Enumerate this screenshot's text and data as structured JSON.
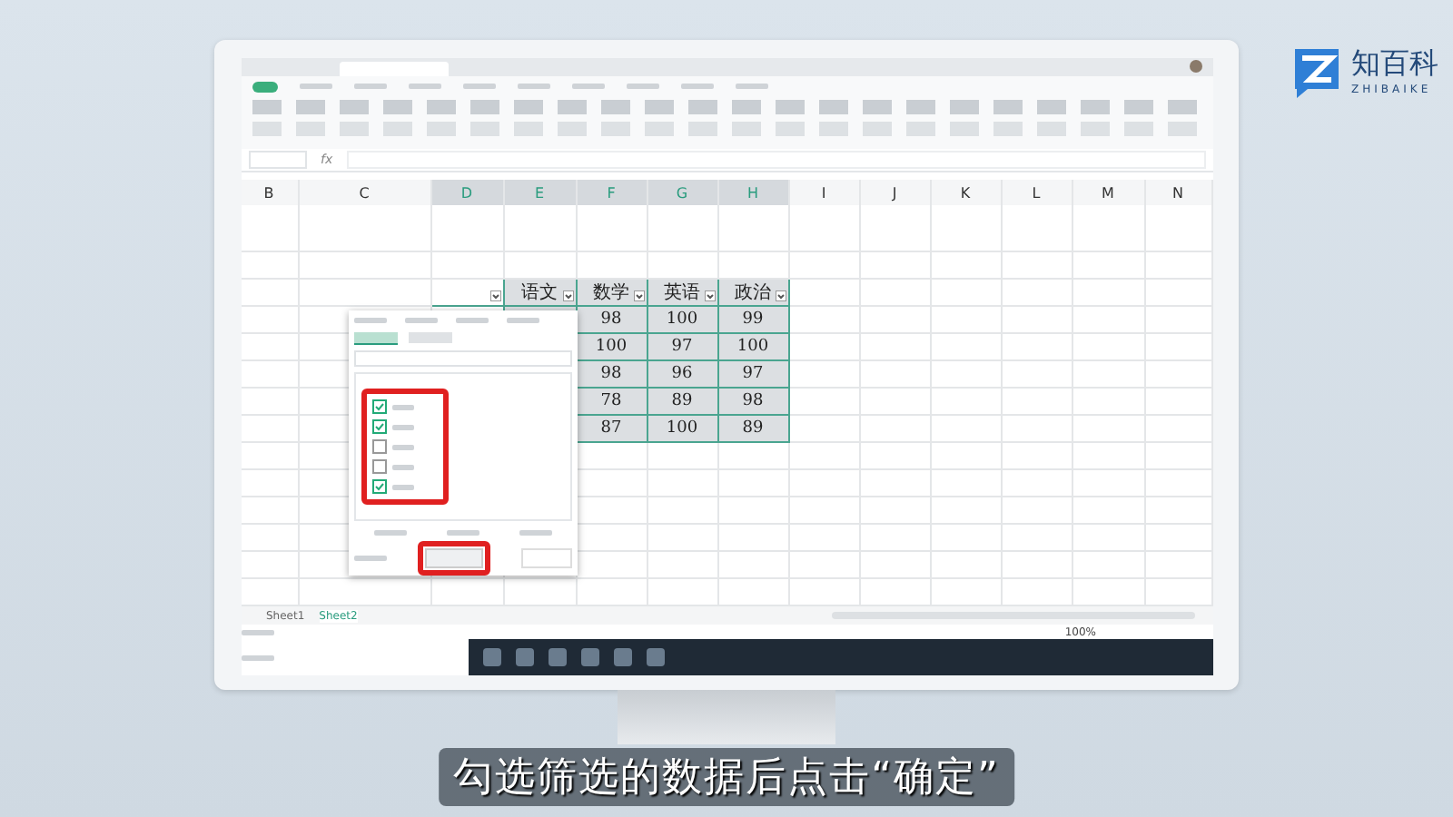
{
  "logo": {
    "name": "知百科",
    "latin": "ZHIBAIKE"
  },
  "spreadsheet": {
    "formula_label": "fx",
    "columns": [
      {
        "letter": "B",
        "selected": false
      },
      {
        "letter": "C",
        "selected": false
      },
      {
        "letter": "D",
        "selected": true
      },
      {
        "letter": "E",
        "selected": true
      },
      {
        "letter": "F",
        "selected": true
      },
      {
        "letter": "G",
        "selected": true
      },
      {
        "letter": "H",
        "selected": true
      },
      {
        "letter": "I",
        "selected": false
      },
      {
        "letter": "J",
        "selected": false
      },
      {
        "letter": "K",
        "selected": false
      },
      {
        "letter": "L",
        "selected": false
      },
      {
        "letter": "M",
        "selected": false
      },
      {
        "letter": "N",
        "selected": false
      }
    ],
    "table": {
      "headers": [
        "语文",
        "数学",
        "英语",
        "政治"
      ],
      "rows": [
        [
          "98",
          "100",
          "99"
        ],
        [
          "100",
          "97",
          "100"
        ],
        [
          "98",
          "96",
          "97"
        ],
        [
          "78",
          "89",
          "98"
        ],
        [
          "87",
          "100",
          "89"
        ]
      ]
    },
    "sheet_tabs": [
      {
        "label": "Sheet1",
        "selected": false
      },
      {
        "label": "Sheet2",
        "selected": true
      }
    ],
    "zoom": "100%"
  },
  "filter_popup": {
    "items": [
      {
        "checked": true
      },
      {
        "checked": true
      },
      {
        "checked": false
      },
      {
        "checked": false
      },
      {
        "checked": true
      }
    ]
  },
  "subtitle": "勾选筛选的数据后点击“确定”"
}
